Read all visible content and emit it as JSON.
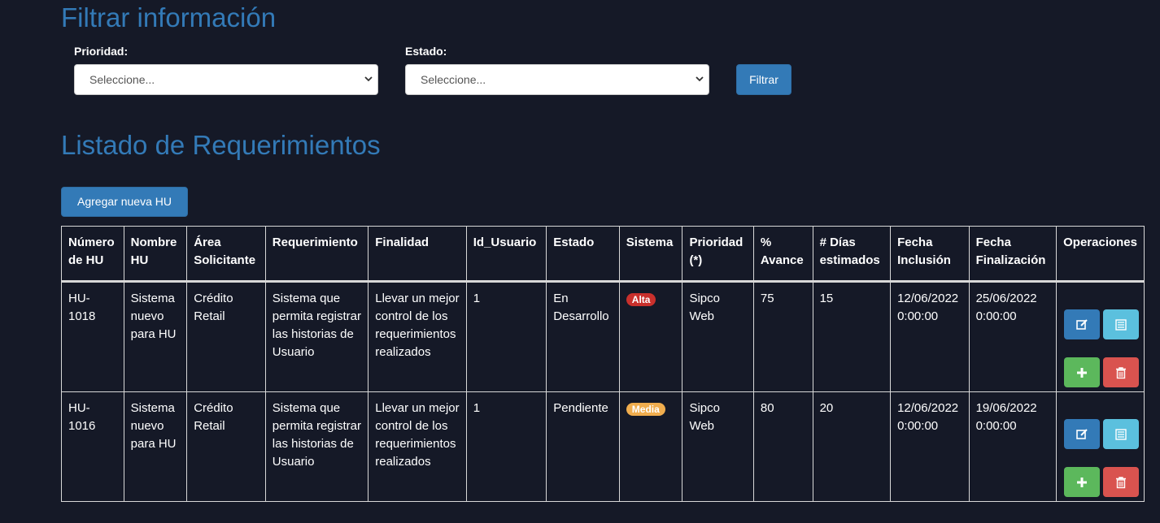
{
  "filter": {
    "title": "Filtrar información",
    "priority_label": "Prioridad:",
    "priority_value": "Seleccione...",
    "state_label": "Estado:",
    "state_value": "Seleccione...",
    "filter_button": "Filtrar"
  },
  "list": {
    "title": "Listado de Requerimientos",
    "add_button": "Agregar nueva HU"
  },
  "colors": {
    "accent": "#337ab7",
    "background": "#151927",
    "priority_alta": "#c9302c",
    "priority_media": "#f0ad4e",
    "edit": "#337ab7",
    "detail": "#5bc0de",
    "add": "#5cb85c",
    "delete": "#d9534f"
  },
  "table": {
    "headers": [
      "Número de HU",
      "Nombre HU",
      "Área Solicitante",
      "Requerimiento",
      "Finalidad",
      "Id_Usuario",
      "Estado",
      "Sistema",
      "Prioridad (*)",
      "% Avance",
      "# Días estimados",
      "Fecha Inclusión",
      "Fecha Finalización",
      "Operaciones"
    ],
    "rows": [
      {
        "numero": "HU-1018",
        "nombre": "Sistema nuevo para HU",
        "area": "Crédito Retail",
        "requerimiento": "Sistema que permita registrar las historias de Usuario",
        "finalidad": "Llevar un mejor control de los requerimientos realizados",
        "id_usuario": "1",
        "estado": "En Desarrollo",
        "sistema_badge": "Alta",
        "prioridad": "Sipco Web",
        "avance": "75",
        "dias": "15",
        "fecha_inclusion": "12/06/2022 0:00:00",
        "fecha_finalizacion": "25/06/2022 0:00:00",
        "operations": [
          "edit-icon",
          "list-icon",
          "plus-icon",
          "trash-icon"
        ]
      },
      {
        "numero": "HU-1016",
        "nombre": "Sistema nuevo para HU",
        "area": "Crédito Retail",
        "requerimiento": "Sistema que permita registrar las historias de Usuario",
        "finalidad": "Llevar un mejor control de los requerimientos realizados",
        "id_usuario": "1",
        "estado": "Pendiente",
        "sistema_badge": "Media",
        "prioridad": "Sipco Web",
        "avance": "80",
        "dias": "20",
        "fecha_inclusion": "12/06/2022 0:00:00",
        "fecha_finalizacion": "19/06/2022 0:00:00",
        "operations": [
          "edit-icon",
          "list-icon",
          "plus-icon",
          "trash-icon"
        ]
      }
    ]
  }
}
